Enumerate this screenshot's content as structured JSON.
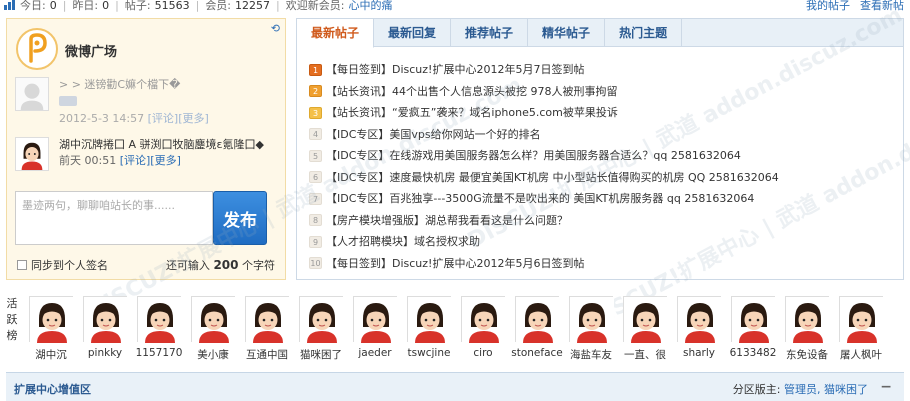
{
  "stats": {
    "today_label": "今日: ",
    "today": "0",
    "yesterday_label": "昨日: ",
    "yesterday": "0",
    "posts_label": "帖子: ",
    "posts": "51563",
    "members_label": "会员: ",
    "members": "12257",
    "welcome_label": "欢迎新会员: ",
    "newest": "心中的痛"
  },
  "top_links": [
    "我的帖子",
    "查看新帖"
  ],
  "weibo": {
    "title": "微博广场",
    "refresh_icon": "refresh-icon",
    "post1": {
      "name": "> > 迷镑勸C嫲个檔下�",
      "meta_time": "2012-5-3 14:57",
      "comment": "[评论]",
      "more": "[更多]"
    },
    "post2": {
      "text": "湖中沉牌捲囗 A 骈渕囗牧脑鏖境ε氪隆囗◆",
      "meta_time": "前天 00:51",
      "comment": "[评论]",
      "more": "[更多]"
    },
    "compose_placeholder": "墨迹两句，聊聊咱站长的事......",
    "publish": "发布",
    "sync": "同步到个人签名",
    "remain_prefix": "还可输入",
    "remain_count": "200",
    "remain_suffix": "个字符"
  },
  "tabs": [
    "最新帖子",
    "最新回复",
    "推荐帖子",
    "精华帖子",
    "热门主题"
  ],
  "active_tab": 0,
  "threads": [
    {
      "n": "1",
      "text": "【每日签到】Discuz!扩展中心2012年5月7日签到帖"
    },
    {
      "n": "2",
      "text": "【站长资讯】44个出售个人信息源头被挖 978人被刑事拘留"
    },
    {
      "n": "3",
      "text": "【站长资讯】“爱疯五”袭来？域名iphone5.com被苹果投诉"
    },
    {
      "n": "4",
      "text": "【IDC专区】美国vps给你网站一个好的排名"
    },
    {
      "n": "5",
      "text": "【IDC专区】在线游戏用美国服务器怎么样？用美国服务器合适么？qq 2581632064"
    },
    {
      "n": "6",
      "text": "【IDC专区】速度最快机房 最便宜美国KT机房 中小型站长值得购买的机房 QQ 2581632064"
    },
    {
      "n": "7",
      "text": "【IDC专区】百兆独享---3500G流量不是吹出来的 美国KT机房服务器 qq 2581632064"
    },
    {
      "n": "8",
      "text": "【房产模块增强版】湖总帮我看看这是什么问题？"
    },
    {
      "n": "9",
      "text": "【人才招聘模块】域名授权求助"
    },
    {
      "n": "10",
      "text": "【每日签到】Discuz!扩展中心2012年5月6日签到帖"
    }
  ],
  "watermark": "DISCUZ!扩展中心 | 武道 addon.discuz.com",
  "active_label": "活跃榜",
  "active_users": [
    "湖中沉",
    "pinkky",
    "1157170",
    "美小康",
    "互通中国",
    "猫咪困了",
    "jaeder",
    "tswcjine",
    "ciro",
    "stoneface",
    "海盐车友",
    "一直、很",
    "sharly",
    "6133482",
    "东免设备",
    "屠人枫叶"
  ],
  "bottom": {
    "zone": "扩展中心增值区",
    "mods_label": "分区版主: ",
    "mods": "管理员, 猫咪困了",
    "collapse": "−"
  },
  "colors": {
    "accent": "#2b6db5",
    "active_tab_text": "#d05a1c",
    "weibo_bg": "#fef8e8"
  }
}
